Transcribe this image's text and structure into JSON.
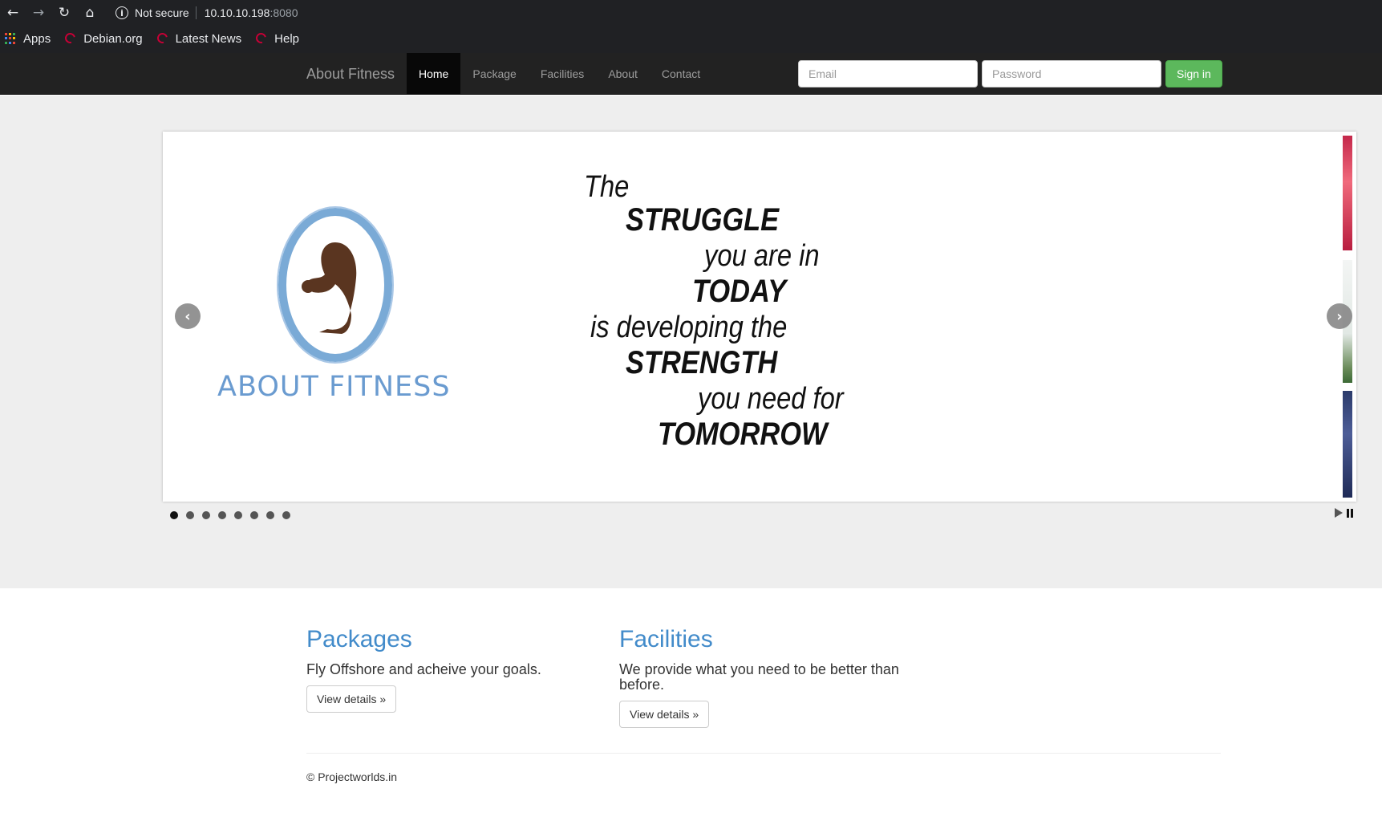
{
  "browser": {
    "security_label": "Not secure",
    "url_host": "10.10.10.198",
    "url_port": ":8080",
    "bookmarks": [
      {
        "label": "Apps",
        "icon": "apps-grid-icon"
      },
      {
        "label": "Debian.org",
        "icon": "debian-swirl-icon"
      },
      {
        "label": "Latest News",
        "icon": "debian-swirl-icon"
      },
      {
        "label": "Help",
        "icon": "debian-swirl-icon"
      }
    ]
  },
  "navbar": {
    "brand": "About Fitness",
    "links": [
      {
        "label": "Home",
        "active": true
      },
      {
        "label": "Package",
        "active": false
      },
      {
        "label": "Facilities",
        "active": false
      },
      {
        "label": "About",
        "active": false
      },
      {
        "label": "Contact",
        "active": false
      }
    ],
    "email_placeholder": "Email",
    "password_placeholder": "Password",
    "signin_label": "Sign in",
    "signin_color": "#5cb85c"
  },
  "slider": {
    "logo_text": "ABOUT FITNESS",
    "quote_lines": [
      "The",
      "STRUGGLE",
      "you are in",
      "TODAY",
      "is developing the",
      "STRENGTH",
      "you need for",
      "TOMORROW"
    ],
    "prev_icon": "chevron-left-icon",
    "next_icon": "chevron-right-icon",
    "slide_count": 8,
    "active_slide": 1
  },
  "sections": [
    {
      "title": "Packages",
      "text": "Fly Offshore and acheive your goals.",
      "button": "View details »"
    },
    {
      "title": "Facilities",
      "text": "We provide what you need to be better than before.",
      "button": "View details »"
    }
  ],
  "footer": {
    "text": "© Projectworlds.in"
  },
  "colors": {
    "link": "#428bca",
    "navbar": "#222222",
    "jumbotron": "#eeeeee",
    "logo_ring": "#7aaad6",
    "logo_figure": "#5a3520"
  }
}
